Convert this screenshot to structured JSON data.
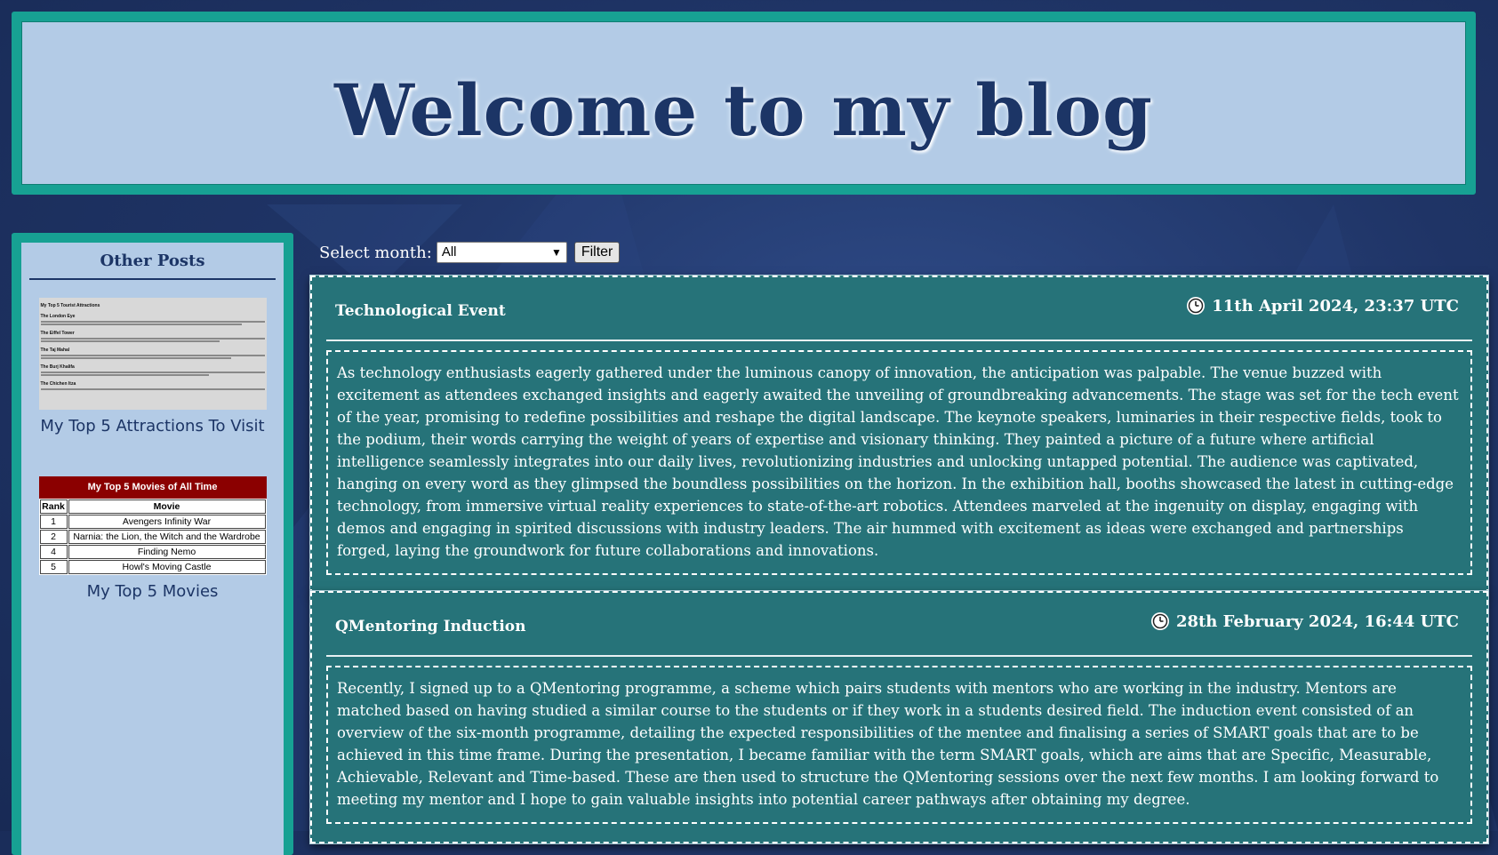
{
  "header": {
    "title": "Welcome to my blog"
  },
  "sidebar": {
    "title": "Other Posts",
    "posts": [
      {
        "label": "My Top 5 Attractions To Visit",
        "thumbnail": {
          "heading": "My Top 5 Tourist Attractions",
          "sections": [
            "The London Eye",
            "The Eiffel Tower",
            "The Taj Mahal",
            "The Burj Khalifa",
            "The Chichen Itza"
          ]
        }
      },
      {
        "label": "My Top 5 Movies",
        "thumbnail": {
          "heading": "My Top 5 Movies of All Time",
          "columns": [
            "Rank",
            "Movie"
          ],
          "rows": [
            [
              "1",
              "Avengers Infinity War"
            ],
            [
              "2",
              "Narnia: the Lion, the Witch and the Wardrobe"
            ],
            [
              "4",
              "Finding Nemo"
            ],
            [
              "5",
              "Howl's Moving Castle"
            ]
          ]
        }
      }
    ]
  },
  "filter": {
    "label": "Select month:",
    "selected": "All",
    "button": "Filter"
  },
  "posts": [
    {
      "title": "Technological Event",
      "date": "11th April 2024, 23:37 UTC",
      "icon": "clock-icon",
      "body": "As technology enthusiasts eagerly gathered under the luminous canopy of innovation, the anticipation was palpable. The venue buzzed with excitement as attendees exchanged insights and eagerly awaited the unveiling of groundbreaking advancements. The stage was set for the tech event of the year, promising to redefine possibilities and reshape the digital landscape. The keynote speakers, luminaries in their respective fields, took to the podium, their words carrying the weight of years of expertise and visionary thinking. They painted a picture of a future where artificial intelligence seamlessly integrates into our daily lives, revolutionizing industries and unlocking untapped potential. The audience was captivated, hanging on every word as they glimpsed the boundless possibilities on the horizon. In the exhibition hall, booths showcased the latest in cutting-edge technology, from immersive virtual reality experiences to state-of-the-art robotics. Attendees marveled at the ingenuity on display, engaging with demos and engaging in spirited discussions with industry leaders. The air hummed with excitement as ideas were exchanged and partnerships forged, laying the groundwork for future collaborations and innovations."
    },
    {
      "title": "QMentoring Induction",
      "date": "28th February 2024, 16:44 UTC",
      "icon": "clock-icon",
      "body": "Recently, I signed up to a QMentoring programme, a scheme which pairs students with mentors who are working in the industry. Mentors are matched based on having studied a similar course to the students or if they work in a students desired field. The induction event consisted of an overview of the six-month programme, detailing the expected responsibilities of the mentee and finalising a series of SMART goals that are to be achieved in this time frame. During the presentation, I became familiar with the term SMART goals, which are aims that are Specific, Measurable, Achievable, Relevant and Time-based. These are then used to structure the QMentoring sessions over the next few months. I am looking forward to meeting my mentor and I hope to gain valuable insights into potential career pathways after obtaining my degree."
    }
  ],
  "colors": {
    "page_background": "#1f3466",
    "panel_background": "#b3cbe6",
    "panel_border": "#17a193",
    "heading_text": "#1c3566",
    "post_background": "#267379",
    "movies_header": "#8b0000"
  }
}
